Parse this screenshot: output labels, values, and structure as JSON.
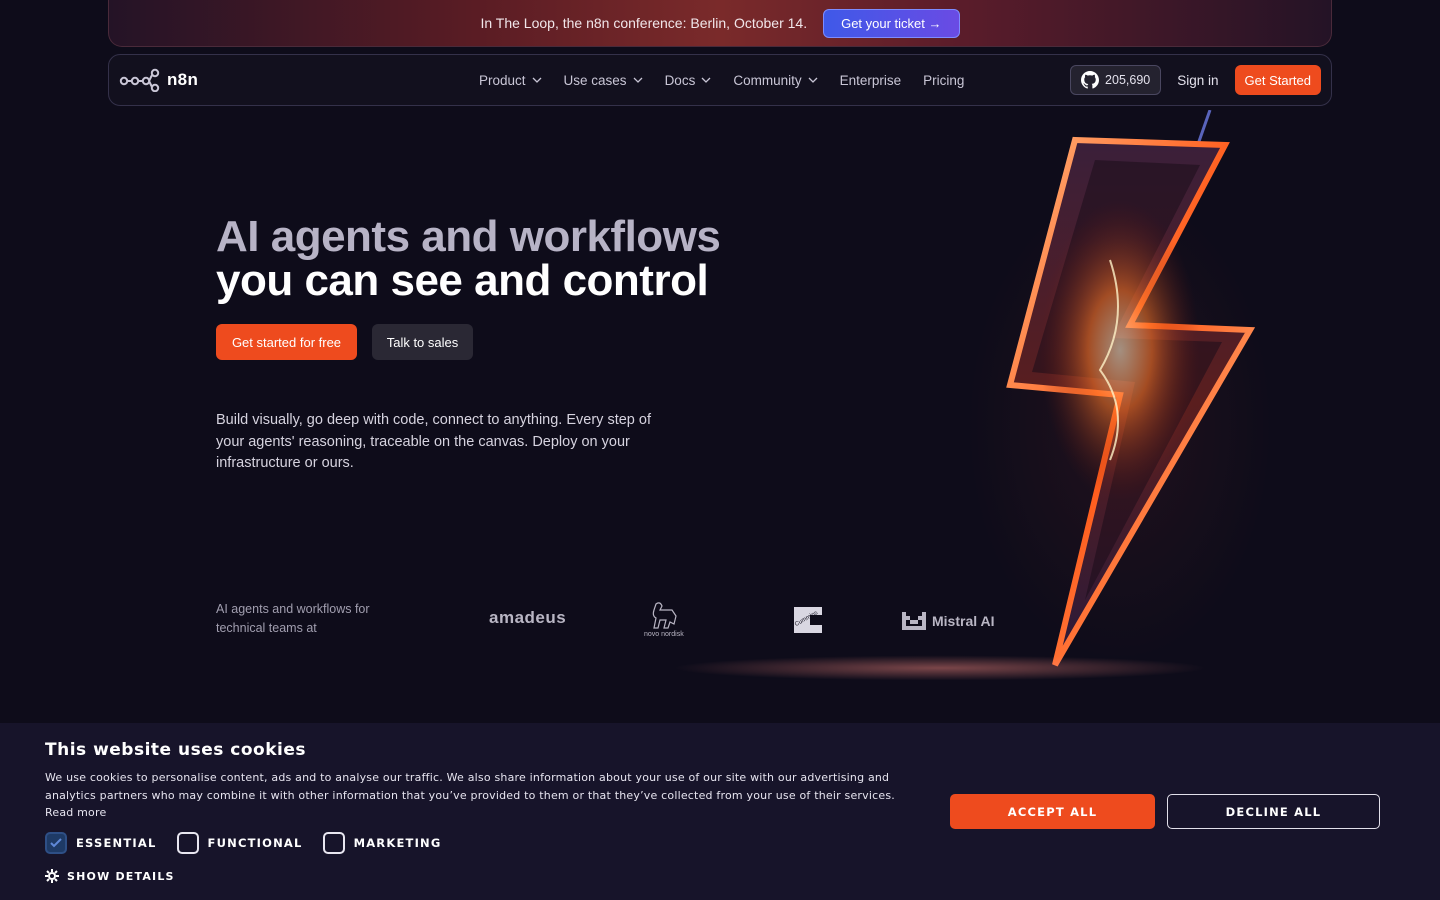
{
  "banner": {
    "text": "In The Loop, the n8n conference: Berlin, October 14.",
    "cta": "Get your ticket →"
  },
  "nav": {
    "logo": "n8n",
    "menu": [
      {
        "label": "Product",
        "dropdown": true
      },
      {
        "label": "Use cases",
        "dropdown": true
      },
      {
        "label": "Docs",
        "dropdown": true
      },
      {
        "label": "Community",
        "dropdown": true
      },
      {
        "label": "Enterprise",
        "dropdown": false
      },
      {
        "label": "Pricing",
        "dropdown": false
      }
    ],
    "github_stars": "205,690",
    "sign_in": "Sign in",
    "get_started": "Get Started"
  },
  "hero": {
    "title_line1": "AI agents and workflows",
    "title_line2": "you can see and control",
    "primary_cta": "Get started for free",
    "secondary_cta": "Talk to sales",
    "description": "Build visually, go deep with code, connect to anything. Every step of your agents' reasoning, traceable on the canvas. Deploy on your infrastructure or ours.",
    "trusted_text": "AI agents and workflows for technical teams at",
    "logos": {
      "amadeus": "amadeus",
      "novo": "novo nordisk",
      "cummins": "Cummins",
      "mistral": "Mistral AI"
    }
  },
  "cookie": {
    "title": "This website uses cookies",
    "text": "We use cookies to personalise content, ads and to analyse our traffic. We also share information about your use of our site with our advertising and analytics partners who may combine it with other information that you’ve provided to them or that they’ve collected from your use of their services.",
    "read_more": "Read more",
    "options": [
      {
        "label": "ESSENTIAL",
        "checked": true
      },
      {
        "label": "FUNCTIONAL",
        "checked": false
      },
      {
        "label": "MARKETING",
        "checked": false
      }
    ],
    "show_details": "SHOW DETAILS",
    "accept": "ACCEPT ALL",
    "decline": "DECLINE ALL"
  },
  "colors": {
    "accent": "#ee4b1e",
    "background": "#0e0c1a",
    "ticket": "#4a55e6"
  }
}
